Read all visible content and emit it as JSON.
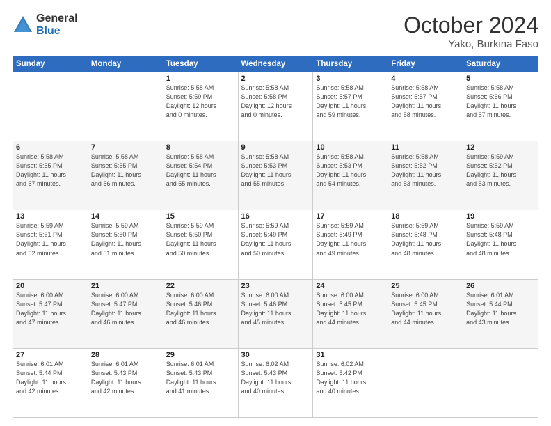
{
  "logo": {
    "general": "General",
    "blue": "Blue"
  },
  "title": "October 2024",
  "location": "Yako, Burkina Faso",
  "headers": [
    "Sunday",
    "Monday",
    "Tuesday",
    "Wednesday",
    "Thursday",
    "Friday",
    "Saturday"
  ],
  "rows": [
    [
      {
        "day": "",
        "info": ""
      },
      {
        "day": "",
        "info": ""
      },
      {
        "day": "1",
        "info": "Sunrise: 5:58 AM\nSunset: 5:59 PM\nDaylight: 12 hours\nand 0 minutes."
      },
      {
        "day": "2",
        "info": "Sunrise: 5:58 AM\nSunset: 5:58 PM\nDaylight: 12 hours\nand 0 minutes."
      },
      {
        "day": "3",
        "info": "Sunrise: 5:58 AM\nSunset: 5:57 PM\nDaylight: 11 hours\nand 59 minutes."
      },
      {
        "day": "4",
        "info": "Sunrise: 5:58 AM\nSunset: 5:57 PM\nDaylight: 11 hours\nand 58 minutes."
      },
      {
        "day": "5",
        "info": "Sunrise: 5:58 AM\nSunset: 5:56 PM\nDaylight: 11 hours\nand 57 minutes."
      }
    ],
    [
      {
        "day": "6",
        "info": "Sunrise: 5:58 AM\nSunset: 5:55 PM\nDaylight: 11 hours\nand 57 minutes."
      },
      {
        "day": "7",
        "info": "Sunrise: 5:58 AM\nSunset: 5:55 PM\nDaylight: 11 hours\nand 56 minutes."
      },
      {
        "day": "8",
        "info": "Sunrise: 5:58 AM\nSunset: 5:54 PM\nDaylight: 11 hours\nand 55 minutes."
      },
      {
        "day": "9",
        "info": "Sunrise: 5:58 AM\nSunset: 5:53 PM\nDaylight: 11 hours\nand 55 minutes."
      },
      {
        "day": "10",
        "info": "Sunrise: 5:58 AM\nSunset: 5:53 PM\nDaylight: 11 hours\nand 54 minutes."
      },
      {
        "day": "11",
        "info": "Sunrise: 5:58 AM\nSunset: 5:52 PM\nDaylight: 11 hours\nand 53 minutes."
      },
      {
        "day": "12",
        "info": "Sunrise: 5:59 AM\nSunset: 5:52 PM\nDaylight: 11 hours\nand 53 minutes."
      }
    ],
    [
      {
        "day": "13",
        "info": "Sunrise: 5:59 AM\nSunset: 5:51 PM\nDaylight: 11 hours\nand 52 minutes."
      },
      {
        "day": "14",
        "info": "Sunrise: 5:59 AM\nSunset: 5:50 PM\nDaylight: 11 hours\nand 51 minutes."
      },
      {
        "day": "15",
        "info": "Sunrise: 5:59 AM\nSunset: 5:50 PM\nDaylight: 11 hours\nand 50 minutes."
      },
      {
        "day": "16",
        "info": "Sunrise: 5:59 AM\nSunset: 5:49 PM\nDaylight: 11 hours\nand 50 minutes."
      },
      {
        "day": "17",
        "info": "Sunrise: 5:59 AM\nSunset: 5:49 PM\nDaylight: 11 hours\nand 49 minutes."
      },
      {
        "day": "18",
        "info": "Sunrise: 5:59 AM\nSunset: 5:48 PM\nDaylight: 11 hours\nand 48 minutes."
      },
      {
        "day": "19",
        "info": "Sunrise: 5:59 AM\nSunset: 5:48 PM\nDaylight: 11 hours\nand 48 minutes."
      }
    ],
    [
      {
        "day": "20",
        "info": "Sunrise: 6:00 AM\nSunset: 5:47 PM\nDaylight: 11 hours\nand 47 minutes."
      },
      {
        "day": "21",
        "info": "Sunrise: 6:00 AM\nSunset: 5:47 PM\nDaylight: 11 hours\nand 46 minutes."
      },
      {
        "day": "22",
        "info": "Sunrise: 6:00 AM\nSunset: 5:46 PM\nDaylight: 11 hours\nand 46 minutes."
      },
      {
        "day": "23",
        "info": "Sunrise: 6:00 AM\nSunset: 5:46 PM\nDaylight: 11 hours\nand 45 minutes."
      },
      {
        "day": "24",
        "info": "Sunrise: 6:00 AM\nSunset: 5:45 PM\nDaylight: 11 hours\nand 44 minutes."
      },
      {
        "day": "25",
        "info": "Sunrise: 6:00 AM\nSunset: 5:45 PM\nDaylight: 11 hours\nand 44 minutes."
      },
      {
        "day": "26",
        "info": "Sunrise: 6:01 AM\nSunset: 5:44 PM\nDaylight: 11 hours\nand 43 minutes."
      }
    ],
    [
      {
        "day": "27",
        "info": "Sunrise: 6:01 AM\nSunset: 5:44 PM\nDaylight: 11 hours\nand 42 minutes."
      },
      {
        "day": "28",
        "info": "Sunrise: 6:01 AM\nSunset: 5:43 PM\nDaylight: 11 hours\nand 42 minutes."
      },
      {
        "day": "29",
        "info": "Sunrise: 6:01 AM\nSunset: 5:43 PM\nDaylight: 11 hours\nand 41 minutes."
      },
      {
        "day": "30",
        "info": "Sunrise: 6:02 AM\nSunset: 5:43 PM\nDaylight: 11 hours\nand 40 minutes."
      },
      {
        "day": "31",
        "info": "Sunrise: 6:02 AM\nSunset: 5:42 PM\nDaylight: 11 hours\nand 40 minutes."
      },
      {
        "day": "",
        "info": ""
      },
      {
        "day": "",
        "info": ""
      }
    ]
  ]
}
